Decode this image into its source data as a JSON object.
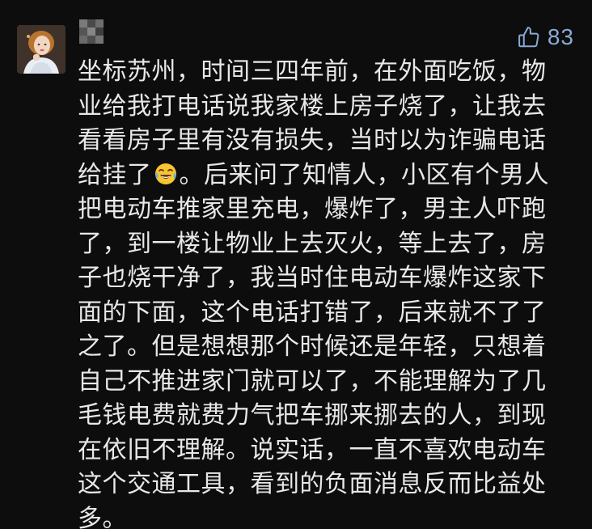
{
  "comment": {
    "like_count": "83",
    "icons": {
      "like": "thumbs-up-icon",
      "emoji": "crying-laughing-emoji"
    },
    "colors": {
      "background": "#0d0d0d",
      "text": "#e8e8e8",
      "like": "#8aa9d6"
    },
    "lines": [
      "坐标苏州，时间三四年前，在外面吃饭，物",
      "业给我打电话说我家楼上房子烧了，让我去",
      "看看房子里有没有损失，当时以为诈骗电话",
      "给挂了",
      "。后来问了知情人，小区有个男人",
      "把电动车推家里充电，爆炸了，男主人吓跑",
      "了，到一楼让物业上去灭火，等上去了，房",
      "子也烧干净了，我当时住电动车爆炸这家下",
      "面的下面，这个电话打错了，后来就不了了",
      "之了。但是想想那个时候还是年轻，只想着",
      "自己不推进家门就可以了，不能理解为了几",
      "毛钱电费就费力气把车挪来挪去的人，到现",
      "在依旧不理解。说实话，一直不喜欢电动车",
      "这个交通工具，看到的负面消息反而比益处",
      "多。"
    ]
  }
}
